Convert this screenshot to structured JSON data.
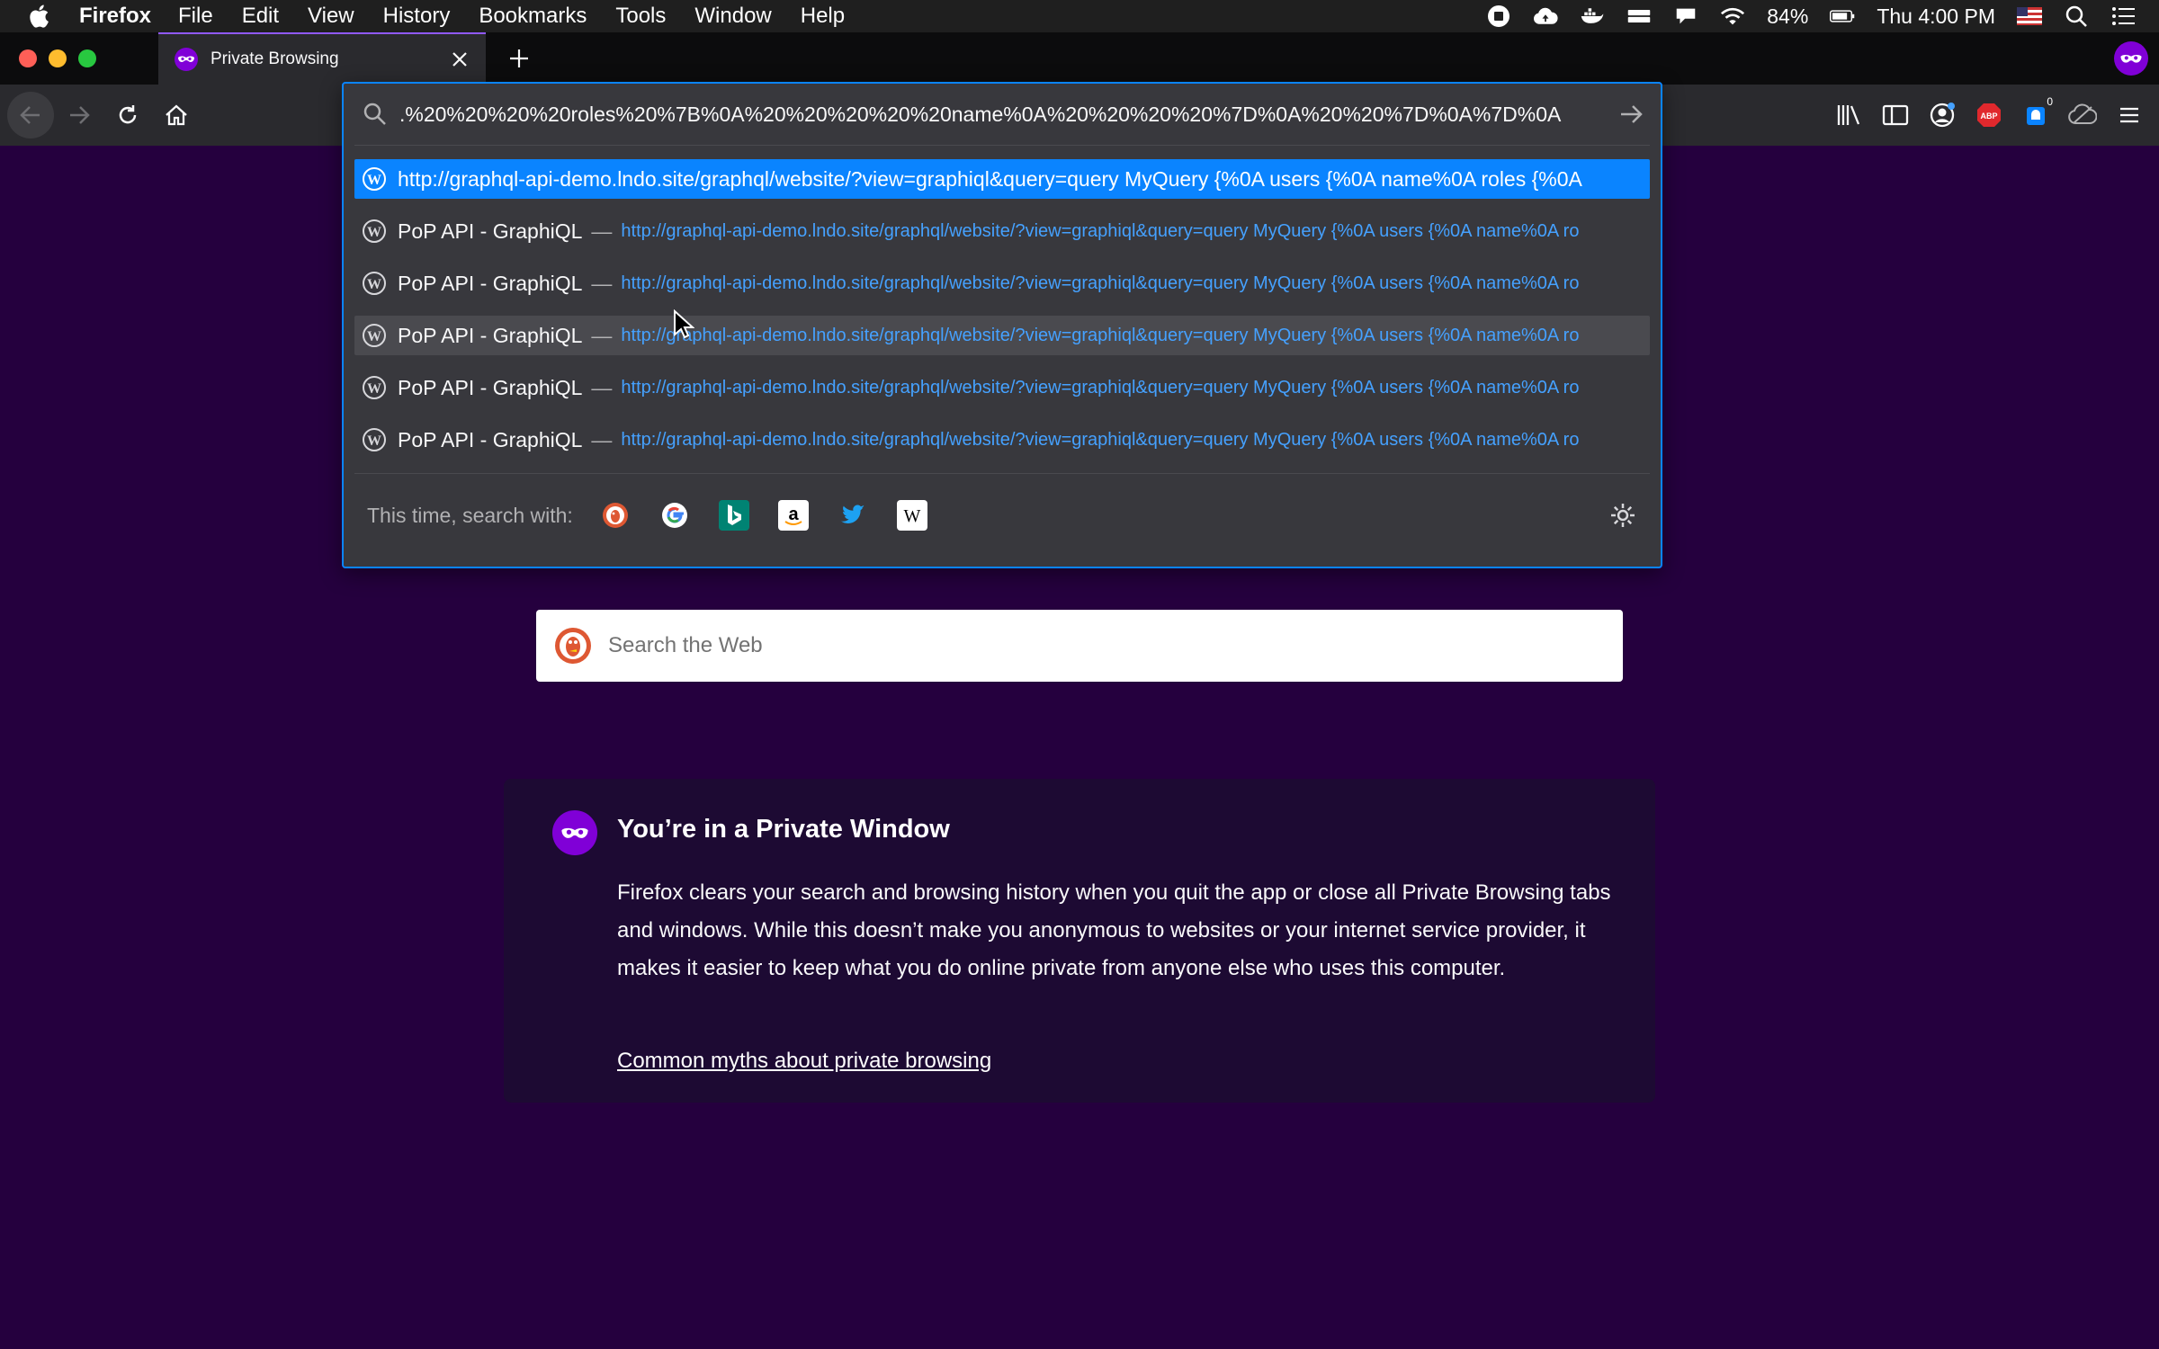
{
  "menubar": {
    "items": [
      "Firefox",
      "File",
      "Edit",
      "View",
      "History",
      "Bookmarks",
      "Tools",
      "Window",
      "Help"
    ],
    "battery": "84%",
    "clock": "Thu 4:00 PM"
  },
  "tab": {
    "title": "Private Browsing"
  },
  "urlbar": {
    "value": ".%20%20%20%20roles%20%7B%0A%20%20%20%20%20name%0A%20%20%20%20%7D%0A%20%20%7D%0A%7D%0A"
  },
  "results": [
    {
      "url": "http://graphql-api-demo.lndo.site/graphql/website/?view=graphiql&query=query MyQuery {%0A users {%0A name%0A roles {%0A"
    },
    {
      "title": "PoP API - GraphiQL",
      "dash": "—",
      "url": "http://graphql-api-demo.lndo.site/graphql/website/?view=graphiql&query=query MyQuery {%0A users {%0A name%0A ro"
    },
    {
      "title": "PoP API - GraphiQL",
      "dash": "—",
      "url": "http://graphql-api-demo.lndo.site/graphql/website/?view=graphiql&query=query MyQuery {%0A users {%0A name%0A ro"
    },
    {
      "title": "PoP API - GraphiQL",
      "dash": "—",
      "url": "http://graphql-api-demo.lndo.site/graphql/website/?view=graphiql&query=query MyQuery {%0A users {%0A name%0A ro"
    },
    {
      "title": "PoP API - GraphiQL",
      "dash": "—",
      "url": "http://graphql-api-demo.lndo.site/graphql/website/?view=graphiql&query=query MyQuery {%0A users {%0A name%0A ro"
    },
    {
      "title": "PoP API - GraphiQL",
      "dash": "—",
      "url": "http://graphql-api-demo.lndo.site/graphql/website/?view=graphiql&query=query MyQuery {%0A users {%0A name%0A ro"
    }
  ],
  "oneoff": {
    "label": "This time, search with:",
    "engines": [
      "duckduckgo-icon",
      "google-icon",
      "bing-icon",
      "amazon-icon",
      "twitter-icon",
      "wikipedia-icon"
    ]
  },
  "toolbar_badge": "0",
  "page": {
    "search_placeholder": "Search the Web",
    "card_heading": "You’re in a Private Window",
    "card_body": "Firefox clears your search and browsing history when you quit the app or close all Private Browsing tabs and windows. While this doesn’t make you anonymous to websites or your internet service provider, it makes it easier to keep what you do online private from anyone else who uses this computer.",
    "myths_link": "Common myths about private browsing"
  },
  "colors": {
    "accent": "#0a84ff",
    "private_purple": "#8000d7",
    "page_bg": "#25003e"
  }
}
